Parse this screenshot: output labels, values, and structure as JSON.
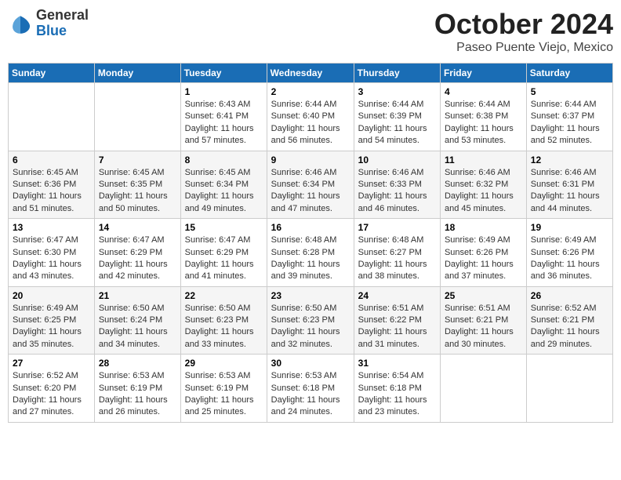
{
  "header": {
    "logo": {
      "general": "General",
      "blue": "Blue"
    },
    "title": "October 2024",
    "location": "Paseo Puente Viejo, Mexico"
  },
  "weekdays": [
    "Sunday",
    "Monday",
    "Tuesday",
    "Wednesday",
    "Thursday",
    "Friday",
    "Saturday"
  ],
  "weeks": [
    [
      {
        "day": "",
        "info": ""
      },
      {
        "day": "",
        "info": ""
      },
      {
        "day": "1",
        "sunrise": "6:43 AM",
        "sunset": "6:41 PM",
        "daylight": "11 hours and 57 minutes."
      },
      {
        "day": "2",
        "sunrise": "6:44 AM",
        "sunset": "6:40 PM",
        "daylight": "11 hours and 56 minutes."
      },
      {
        "day": "3",
        "sunrise": "6:44 AM",
        "sunset": "6:39 PM",
        "daylight": "11 hours and 54 minutes."
      },
      {
        "day": "4",
        "sunrise": "6:44 AM",
        "sunset": "6:38 PM",
        "daylight": "11 hours and 53 minutes."
      },
      {
        "day": "5",
        "sunrise": "6:44 AM",
        "sunset": "6:37 PM",
        "daylight": "11 hours and 52 minutes."
      }
    ],
    [
      {
        "day": "6",
        "sunrise": "6:45 AM",
        "sunset": "6:36 PM",
        "daylight": "11 hours and 51 minutes."
      },
      {
        "day": "7",
        "sunrise": "6:45 AM",
        "sunset": "6:35 PM",
        "daylight": "11 hours and 50 minutes."
      },
      {
        "day": "8",
        "sunrise": "6:45 AM",
        "sunset": "6:34 PM",
        "daylight": "11 hours and 49 minutes."
      },
      {
        "day": "9",
        "sunrise": "6:46 AM",
        "sunset": "6:34 PM",
        "daylight": "11 hours and 47 minutes."
      },
      {
        "day": "10",
        "sunrise": "6:46 AM",
        "sunset": "6:33 PM",
        "daylight": "11 hours and 46 minutes."
      },
      {
        "day": "11",
        "sunrise": "6:46 AM",
        "sunset": "6:32 PM",
        "daylight": "11 hours and 45 minutes."
      },
      {
        "day": "12",
        "sunrise": "6:46 AM",
        "sunset": "6:31 PM",
        "daylight": "11 hours and 44 minutes."
      }
    ],
    [
      {
        "day": "13",
        "sunrise": "6:47 AM",
        "sunset": "6:30 PM",
        "daylight": "11 hours and 43 minutes."
      },
      {
        "day": "14",
        "sunrise": "6:47 AM",
        "sunset": "6:29 PM",
        "daylight": "11 hours and 42 minutes."
      },
      {
        "day": "15",
        "sunrise": "6:47 AM",
        "sunset": "6:29 PM",
        "daylight": "11 hours and 41 minutes."
      },
      {
        "day": "16",
        "sunrise": "6:48 AM",
        "sunset": "6:28 PM",
        "daylight": "11 hours and 39 minutes."
      },
      {
        "day": "17",
        "sunrise": "6:48 AM",
        "sunset": "6:27 PM",
        "daylight": "11 hours and 38 minutes."
      },
      {
        "day": "18",
        "sunrise": "6:49 AM",
        "sunset": "6:26 PM",
        "daylight": "11 hours and 37 minutes."
      },
      {
        "day": "19",
        "sunrise": "6:49 AM",
        "sunset": "6:26 PM",
        "daylight": "11 hours and 36 minutes."
      }
    ],
    [
      {
        "day": "20",
        "sunrise": "6:49 AM",
        "sunset": "6:25 PM",
        "daylight": "11 hours and 35 minutes."
      },
      {
        "day": "21",
        "sunrise": "6:50 AM",
        "sunset": "6:24 PM",
        "daylight": "11 hours and 34 minutes."
      },
      {
        "day": "22",
        "sunrise": "6:50 AM",
        "sunset": "6:23 PM",
        "daylight": "11 hours and 33 minutes."
      },
      {
        "day": "23",
        "sunrise": "6:50 AM",
        "sunset": "6:23 PM",
        "daylight": "11 hours and 32 minutes."
      },
      {
        "day": "24",
        "sunrise": "6:51 AM",
        "sunset": "6:22 PM",
        "daylight": "11 hours and 31 minutes."
      },
      {
        "day": "25",
        "sunrise": "6:51 AM",
        "sunset": "6:21 PM",
        "daylight": "11 hours and 30 minutes."
      },
      {
        "day": "26",
        "sunrise": "6:52 AM",
        "sunset": "6:21 PM",
        "daylight": "11 hours and 29 minutes."
      }
    ],
    [
      {
        "day": "27",
        "sunrise": "6:52 AM",
        "sunset": "6:20 PM",
        "daylight": "11 hours and 27 minutes."
      },
      {
        "day": "28",
        "sunrise": "6:53 AM",
        "sunset": "6:19 PM",
        "daylight": "11 hours and 26 minutes."
      },
      {
        "day": "29",
        "sunrise": "6:53 AM",
        "sunset": "6:19 PM",
        "daylight": "11 hours and 25 minutes."
      },
      {
        "day": "30",
        "sunrise": "6:53 AM",
        "sunset": "6:18 PM",
        "daylight": "11 hours and 24 minutes."
      },
      {
        "day": "31",
        "sunrise": "6:54 AM",
        "sunset": "6:18 PM",
        "daylight": "11 hours and 23 minutes."
      },
      {
        "day": "",
        "info": ""
      },
      {
        "day": "",
        "info": ""
      }
    ]
  ],
  "labels": {
    "sunrise": "Sunrise: ",
    "sunset": "Sunset: ",
    "daylight": "Daylight: "
  }
}
